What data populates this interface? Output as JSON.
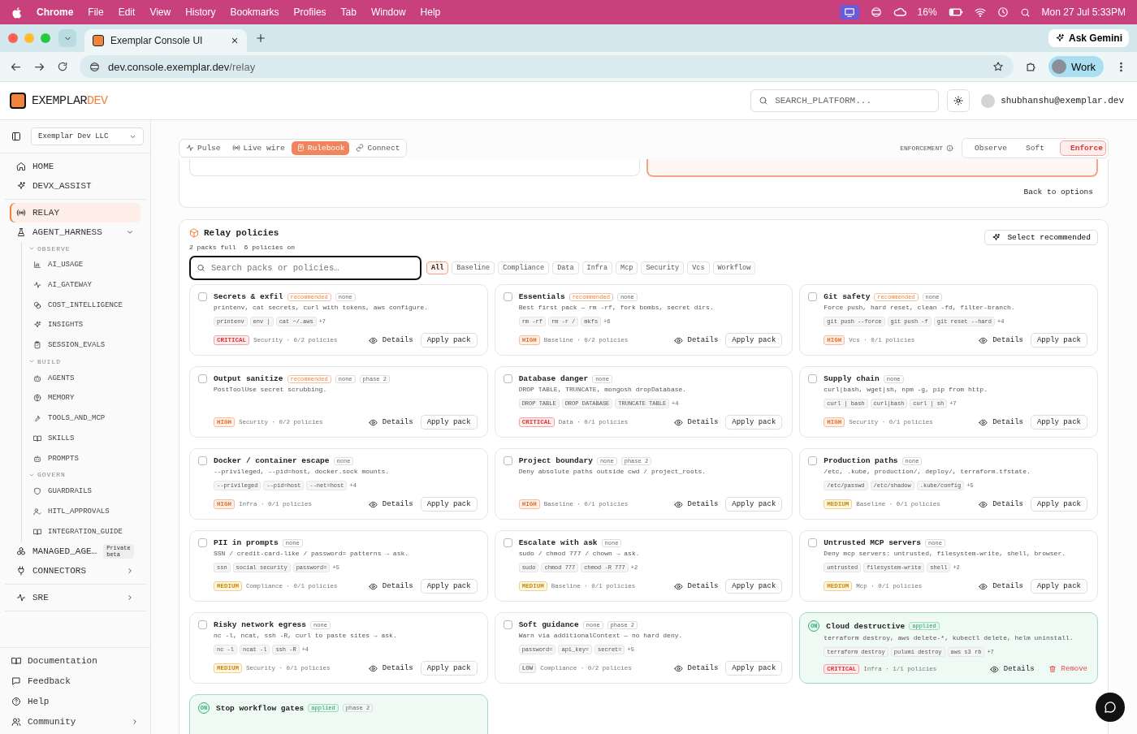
{
  "menubar": {
    "app": "Chrome",
    "menus": [
      "File",
      "Edit",
      "View",
      "History",
      "Bookmarks",
      "Profiles",
      "Tab",
      "Window",
      "Help"
    ],
    "battery": "16%",
    "clock": "Mon 27 Jul  5:33PM"
  },
  "browser": {
    "tab_title": "Exemplar Console UI",
    "gemini": "Ask Gemini",
    "url_host": "dev.console.exemplar.dev",
    "url_path": "/relay",
    "profile": "Work"
  },
  "header": {
    "logo_main": "EXEMPLAR",
    "logo_accent": "DEV",
    "search_placeholder": "SEARCH_PLATFORM...",
    "user": "shubhanshu@exemplar.dev"
  },
  "sidebar": {
    "org": "Exemplar Dev LLC",
    "sections": [
      {
        "items": [
          {
            "label": "HOME",
            "selected": false
          },
          {
            "label": "DEVX_ASSIST",
            "selected": false
          }
        ]
      },
      {
        "items": [
          {
            "label": "RELAY",
            "selected": true
          },
          {
            "label": "AGENT_HARNESS",
            "selected": false,
            "expanded": true,
            "children": [
              {
                "label": "OBSERVE",
                "kind": "group",
                "expanded": true,
                "children": [
                  {
                    "label": "AI_USAGE",
                    "selected": false
                  },
                  {
                    "label": "AI_GATEWAY",
                    "selected": false
                  },
                  {
                    "label": "COST_INTELLIGENCE",
                    "selected": false
                  },
                  {
                    "label": "INSIGHTS",
                    "selected": false
                  },
                  {
                    "label": "SESSION_EVALS",
                    "selected": false
                  }
                ]
              },
              {
                "label": "BUILD",
                "kind": "group",
                "expanded": true,
                "children": [
                  {
                    "label": "AGENTS",
                    "selected": false
                  },
                  {
                    "label": "MEMORY",
                    "selected": false
                  },
                  {
                    "label": "TOOLS_AND_MCP",
                    "selected": false
                  },
                  {
                    "label": "SKILLS",
                    "selected": false
                  },
                  {
                    "label": "PROMPTS",
                    "selected": false
                  }
                ]
              },
              {
                "label": "GOVERN",
                "kind": "group",
                "expanded": true,
                "children": [
                  {
                    "label": "GUARDRAILS",
                    "selected": false
                  },
                  {
                    "label": "HITL_APPROVALS",
                    "selected": false
                  },
                  {
                    "label": "INTEGRATION_GUIDE",
                    "selected": false
                  }
                ]
              }
            ]
          },
          {
            "label": "MANAGED_AGE…",
            "selected": false,
            "badge": "Private beta"
          },
          {
            "label": "CONNECTORS",
            "selected": false,
            "expanded": false
          }
        ]
      },
      {
        "items": [
          {
            "label": "SRE",
            "selected": false,
            "expanded": false
          }
        ]
      }
    ],
    "footer": [
      {
        "label": "Documentation"
      },
      {
        "label": "Feedback"
      },
      {
        "label": "Help"
      },
      {
        "label": "Community",
        "expanded": false
      }
    ]
  },
  "toolbar": {
    "tabs": [
      {
        "label": "Pulse",
        "selected": false
      },
      {
        "label": "Live wire",
        "selected": false
      },
      {
        "label": "Rulebook",
        "selected": true
      },
      {
        "label": "Connect",
        "selected": false
      }
    ],
    "enforcement_label": "ENFORCEMENT",
    "modes": [
      {
        "label": "Observe",
        "selected": false
      },
      {
        "label": "Soft",
        "selected": false
      },
      {
        "label": "Enforce",
        "selected": true
      }
    ]
  },
  "options_panel": {
    "options": [
      {
        "selected": false
      },
      {
        "selected": true
      }
    ],
    "back": "Back to options"
  },
  "policies": {
    "title": "Relay policies",
    "stats": [
      "2 packs full",
      "6 policies on"
    ],
    "select_recommended": "Select recommended",
    "search_placeholder": "Search packs or policies…",
    "filters": [
      {
        "label": "All",
        "selected": true
      },
      {
        "label": "Baseline",
        "selected": false
      },
      {
        "label": "Compliance",
        "selected": false
      },
      {
        "label": "Data",
        "selected": false
      },
      {
        "label": "Infra",
        "selected": false
      },
      {
        "label": "Mcp",
        "selected": false
      },
      {
        "label": "Security",
        "selected": false
      },
      {
        "label": "Vcs",
        "selected": false
      },
      {
        "label": "Workflow",
        "selected": false
      }
    ],
    "packs": [
      {
        "title": "Secrets & exfil",
        "applied": false,
        "checked": false,
        "tags": [
          {
            "text": "recommended",
            "kind": "recommended"
          },
          {
            "text": "none",
            "kind": "plain"
          }
        ],
        "description": "printenv, cat secrets, curl with tokens, aws configure.",
        "chips": [
          "printenv",
          "env |",
          "cat ~/.aws"
        ],
        "more": "+7",
        "severity": {
          "text": "CRITICAL",
          "kind": "critical"
        },
        "meta": "Security · 0/2 policies",
        "details": "Details",
        "action": "Apply pack"
      },
      {
        "title": "Essentials",
        "applied": false,
        "checked": false,
        "tags": [
          {
            "text": "recommended",
            "kind": "recommended"
          },
          {
            "text": "none",
            "kind": "plain"
          }
        ],
        "description": "Best first pack — rm -rf, fork bombs, secret dirs.",
        "chips": [
          "rm -rf",
          "rm -r /",
          "mkfs"
        ],
        "more": "+6",
        "severity": {
          "text": "HIGH",
          "kind": "high"
        },
        "meta": "Baseline · 0/2 policies",
        "details": "Details",
        "action": "Apply pack"
      },
      {
        "title": "Git safety",
        "applied": false,
        "checked": false,
        "tags": [
          {
            "text": "recommended",
            "kind": "recommended"
          },
          {
            "text": "none",
            "kind": "plain"
          }
        ],
        "description": "Force push, hard reset, clean -fd, filter-branch.",
        "chips": [
          "git push --force",
          "git push -f",
          "git reset --hard"
        ],
        "more": "+4",
        "severity": {
          "text": "HIGH",
          "kind": "high"
        },
        "meta": "Vcs · 0/1 policies",
        "details": "Details",
        "action": "Apply pack"
      },
      {
        "title": "Output sanitize",
        "applied": false,
        "checked": false,
        "tags": [
          {
            "text": "recommended",
            "kind": "recommended"
          },
          {
            "text": "none",
            "kind": "plain"
          },
          {
            "text": "phase 2",
            "kind": "plain"
          }
        ],
        "description": "PostToolUse secret scrubbing.",
        "severity": {
          "text": "HIGH",
          "kind": "high"
        },
        "meta": "Security · 0/2 policies",
        "details": "Details",
        "action": "Apply pack"
      },
      {
        "title": "Database danger",
        "applied": false,
        "checked": false,
        "tags": [
          {
            "text": "none",
            "kind": "plain"
          }
        ],
        "description": "DROP TABLE, TRUNCATE, mongosh dropDatabase.",
        "chips": [
          "DROP TABLE",
          "DROP DATABASE",
          "TRUNCATE TABLE"
        ],
        "more": "+4",
        "severity": {
          "text": "CRITICAL",
          "kind": "critical"
        },
        "meta": "Data · 0/1 policies",
        "details": "Details",
        "action": "Apply pack"
      },
      {
        "title": "Supply chain",
        "applied": false,
        "checked": false,
        "tags": [
          {
            "text": "none",
            "kind": "plain"
          }
        ],
        "description": "curl|bash, wget|sh, npm -g, pip from http.",
        "chips": [
          "curl | bash",
          "curl|bash",
          "curl | sh"
        ],
        "more": "+7",
        "severity": {
          "text": "HIGH",
          "kind": "high"
        },
        "meta": "Security · 0/1 policies",
        "details": "Details",
        "action": "Apply pack"
      },
      {
        "title": "Docker / container escape",
        "applied": false,
        "checked": false,
        "tags": [
          {
            "text": "none",
            "kind": "plain"
          }
        ],
        "description": "--privileged, --pid=host, docker.sock mounts.",
        "chips": [
          "--privileged",
          "--pid=host",
          "--net=host"
        ],
        "more": "+4",
        "severity": {
          "text": "HIGH",
          "kind": "high"
        },
        "meta": "Infra · 0/1 policies",
        "details": "Details",
        "action": "Apply pack"
      },
      {
        "title": "Project boundary",
        "applied": false,
        "checked": false,
        "tags": [
          {
            "text": "none",
            "kind": "plain"
          },
          {
            "text": "phase 2",
            "kind": "plain"
          }
        ],
        "description": "Deny absolute paths outside cwd / project_roots.",
        "severity": {
          "text": "HIGH",
          "kind": "high"
        },
        "meta": "Baseline · 0/1 policies",
        "details": "Details",
        "action": "Apply pack"
      },
      {
        "title": "Production paths",
        "applied": false,
        "checked": false,
        "tags": [
          {
            "text": "none",
            "kind": "plain"
          }
        ],
        "description": "/etc, .kube, production/, deploy/, terraform.tfstate.",
        "chips": [
          "/etc/passwd",
          "/etc/shadow",
          ".kube/config"
        ],
        "more": "+5",
        "severity": {
          "text": "MEDIUM",
          "kind": "medium"
        },
        "meta": "Baseline · 0/1 policies",
        "details": "Details",
        "action": "Apply pack"
      },
      {
        "title": "PII in prompts",
        "applied": false,
        "checked": false,
        "tags": [
          {
            "text": "none",
            "kind": "plain"
          }
        ],
        "description": "SSN / credit-card-like / password= patterns → ask.",
        "chips": [
          "ssn",
          "social security",
          "password="
        ],
        "more": "+5",
        "severity": {
          "text": "MEDIUM",
          "kind": "medium"
        },
        "meta": "Compliance · 0/1 policies",
        "details": "Details",
        "action": "Apply pack"
      },
      {
        "title": "Escalate with ask",
        "applied": false,
        "checked": false,
        "tags": [
          {
            "text": "none",
            "kind": "plain"
          }
        ],
        "description": "sudo / chmod 777 / chown → ask.",
        "chips": [
          "sudo",
          "chmod 777",
          "chmod -R 777"
        ],
        "more": "+2",
        "severity": {
          "text": "MEDIUM",
          "kind": "medium"
        },
        "meta": "Baseline · 0/1 policies",
        "details": "Details",
        "action": "Apply pack"
      },
      {
        "title": "Untrusted MCP servers",
        "applied": false,
        "checked": false,
        "tags": [
          {
            "text": "none",
            "kind": "plain"
          }
        ],
        "description": "Deny mcp servers: untrusted, filesystem-write, shell, browser.",
        "chips": [
          "untrusted",
          "filesystem-write",
          "shell"
        ],
        "more": "+2",
        "severity": {
          "text": "MEDIUM",
          "kind": "medium"
        },
        "meta": "Mcp · 0/1 policies",
        "details": "Details",
        "action": "Apply pack"
      },
      {
        "title": "Risky network egress",
        "applied": false,
        "checked": false,
        "tags": [
          {
            "text": "none",
            "kind": "plain"
          }
        ],
        "description": "nc -l, ncat, ssh -R, curl to paste sites → ask.",
        "chips": [
          "nc -l",
          "ncat -l",
          "ssh -R"
        ],
        "more": "+4",
        "severity": {
          "text": "MEDIUM",
          "kind": "medium"
        },
        "meta": "Security · 0/1 policies",
        "details": "Details",
        "action": "Apply pack"
      },
      {
        "title": "Soft guidance",
        "applied": false,
        "checked": false,
        "tags": [
          {
            "text": "none",
            "kind": "plain"
          },
          {
            "text": "phase 2",
            "kind": "plain"
          }
        ],
        "description": "Warn via additionalContext — no hard deny.",
        "chips": [
          "password=",
          "api_key=",
          "secret="
        ],
        "more": "+5",
        "severity": {
          "text": "LOW",
          "kind": "low"
        },
        "meta": "Compliance · 0/2 policies",
        "details": "Details",
        "action": "Apply pack"
      },
      {
        "title": "Cloud destructive",
        "applied": true,
        "on_label": "ON",
        "tags": [
          {
            "text": "applied",
            "kind": "applied"
          }
        ],
        "description": "terraform destroy, aws delete-*, kubectl delete, helm uninstall.",
        "chips": [
          "terraform destroy",
          "pulumi destroy",
          "aws s3 rb"
        ],
        "more": "+7",
        "severity": {
          "text": "CRITICAL",
          "kind": "critical"
        },
        "meta": "Infra · 1/1 policies",
        "details": "Details",
        "action": "Remove"
      },
      {
        "title": "Stop workflow gates",
        "applied": true,
        "on_label": "ON",
        "tags": [
          {
            "text": "applied",
            "kind": "applied"
          },
          {
            "text": "phase 2",
            "kind": "plain"
          }
        ]
      }
    ]
  }
}
